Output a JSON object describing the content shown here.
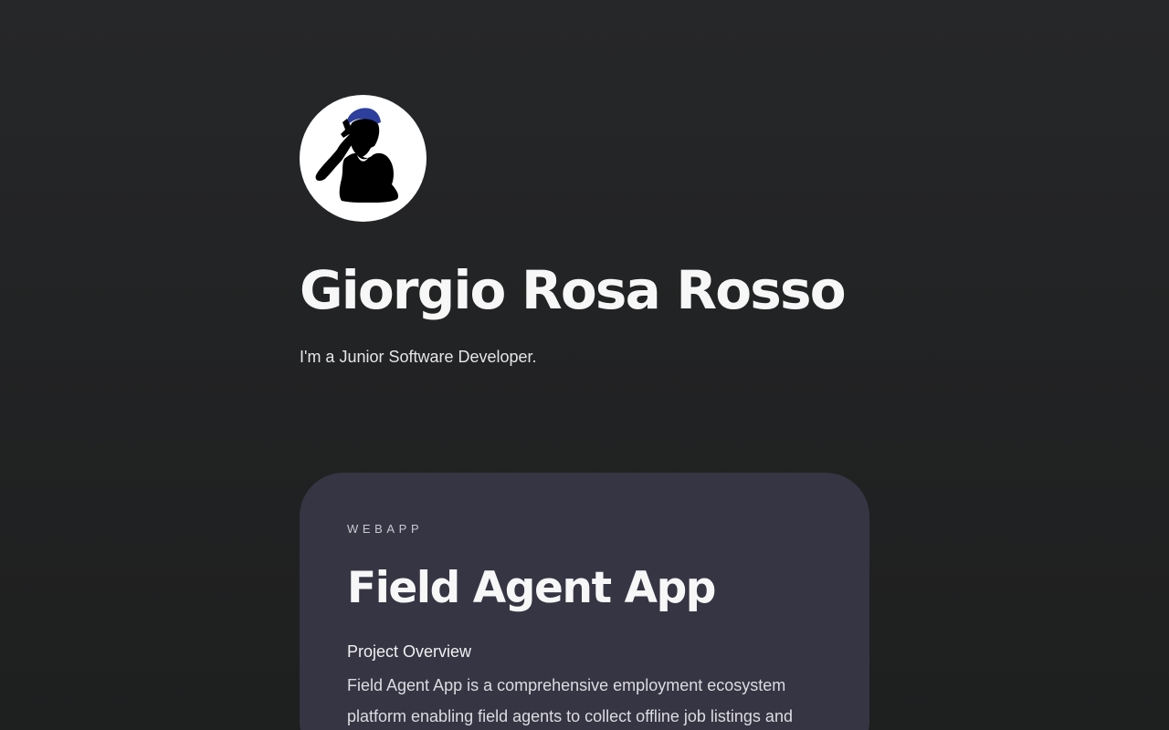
{
  "profile": {
    "avatar_icon": "person-silhouette-icon",
    "name": "Giorgio Rosa Rosso",
    "tagline": "I'm a Junior Software Developer."
  },
  "project_card": {
    "category": "WEBAPP",
    "title": "Field Agent App",
    "section_heading": "Project Overview",
    "description": "Field Agent App is a comprehensive employment ecosystem platform enabling field agents to collect offline job listings and"
  },
  "colors": {
    "background": "#242526",
    "card": "#363543",
    "avatar_cap": "#2d3f9c"
  }
}
